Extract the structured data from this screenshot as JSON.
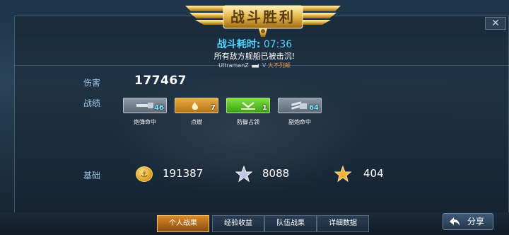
{
  "banner": {
    "title": "战斗胜利"
  },
  "battle": {
    "time_label": "战斗耗时:",
    "time_value": "07:36",
    "result": "所有敌方舰船已被击沉!",
    "killer": "UltramanZ",
    "vs": "V",
    "sunk": "大不列颠"
  },
  "damage": {
    "label": "伤害",
    "value": "177467"
  },
  "record": {
    "label": "战绩",
    "badges": [
      {
        "name": "炮弹命中",
        "count": "46",
        "color": "#8b98a6"
      },
      {
        "name": "点燃",
        "count": "7",
        "color": "#e7ab3c"
      },
      {
        "name": "防御占领",
        "count": "1",
        "color": "#7fe33a"
      },
      {
        "name": "副炮命中",
        "count": "64",
        "color": "#8b98a6"
      }
    ]
  },
  "base": {
    "label": "基础",
    "coin": "191387",
    "exp": "8088",
    "rank": "404"
  },
  "tabs": [
    {
      "label": "个人战果",
      "active": true
    },
    {
      "label": "经验收益",
      "active": false
    },
    {
      "label": "队伍战果",
      "active": false
    },
    {
      "label": "详细数据",
      "active": false
    }
  ],
  "share": {
    "label": "分享"
  },
  "close": {
    "label": "✕"
  },
  "colors": {
    "accent": "#4fd2ff",
    "active_tab": "#d98a2a",
    "label": "#9ec3e0"
  },
  "icons": {
    "coin": "anchor-coin-icon",
    "exp": "silver-star-icon",
    "rank": "gold-star-icon",
    "share": "share-arrow-icon"
  }
}
